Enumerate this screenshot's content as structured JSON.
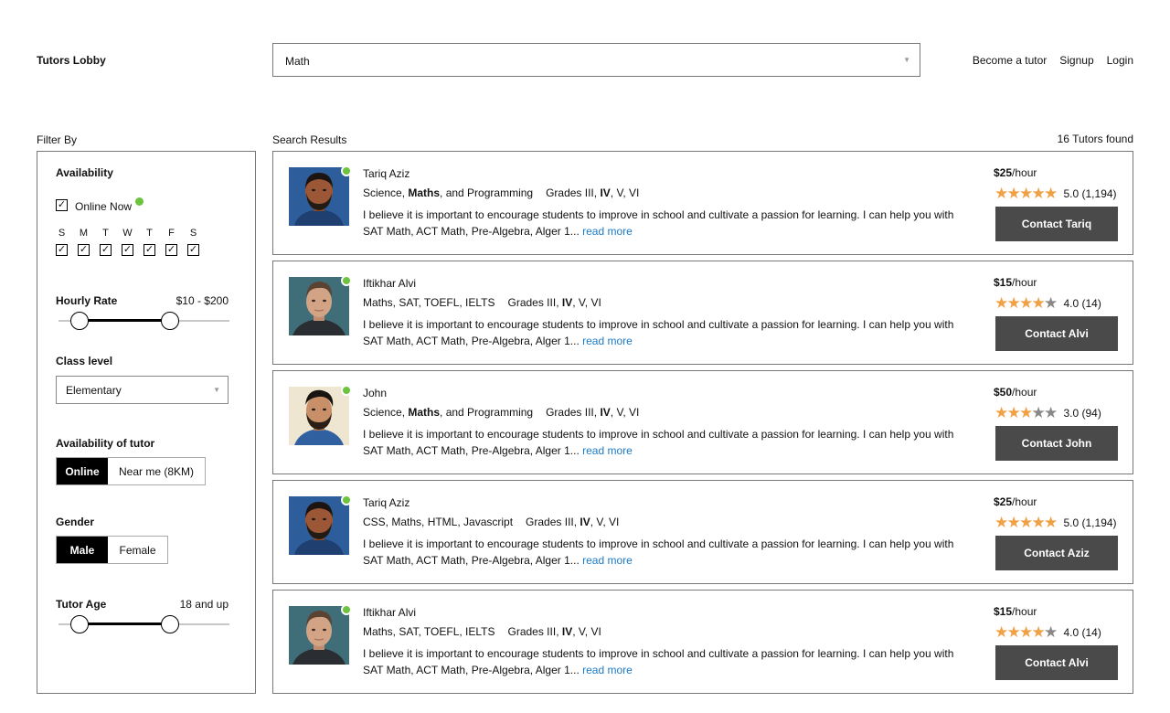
{
  "header": {
    "logo": "Tutors Lobby",
    "subject_select": "Math",
    "nav": [
      "Become a tutor",
      "Signup",
      "Login"
    ]
  },
  "filter": {
    "title": "Filter By",
    "availability_title": "Availability",
    "online_now_label": "Online Now",
    "online_now_checked": true,
    "days": [
      "S",
      "M",
      "T",
      "W",
      "T",
      "F",
      "S"
    ],
    "days_checked": [
      true,
      true,
      true,
      true,
      true,
      true,
      true
    ],
    "hourly_rate_title": "Hourly Rate",
    "hourly_rate_range": "$10 - $200",
    "class_level_title": "Class level",
    "class_level_value": "Elementary",
    "availability_tutor_title": "Availability of tutor",
    "availability_options": [
      "Online",
      "Near me (8KM)"
    ],
    "availability_selected": "Online",
    "gender_title": "Gender",
    "gender_options": [
      "Male",
      "Female"
    ],
    "gender_selected": "Male",
    "age_title": "Tutor Age",
    "age_range": "18 and up"
  },
  "results": {
    "label": "Search Results",
    "found": "16 Tutors found",
    "read_more": "read more",
    "per_hour": "/hour",
    "tutors": [
      {
        "name": "Tariq Aziz",
        "subjects": [
          "Science, ",
          "Maths",
          ", and Programming"
        ],
        "grades": [
          "Grades III, ",
          "IV",
          ", V, VI"
        ],
        "description": "I believe it is important to encourage students to improve in school and cultivate a passion for learning. I can help you with SAT Math, ACT Math, Pre-Algebra, Alger 1...",
        "price": "$25",
        "rating": 5.0,
        "rating_text": "5.0 (1,194)",
        "contact": "Contact Tariq",
        "avatar": "man-beard-blue-icon"
      },
      {
        "name": "Iftikhar Alvi",
        "subjects": [
          "Maths, SAT, TOEFL, IELTS",
          "",
          ""
        ],
        "grades": [
          "Grades III, ",
          "IV",
          ", V, VI"
        ],
        "description": "I believe it is important to encourage students to improve in school and cultivate a passion for learning. I can help you with SAT Math, ACT Math, Pre-Algebra, Alger 1...",
        "price": "$15",
        "rating": 4.0,
        "rating_text": "4.0 (14)",
        "contact": "Contact Alvi",
        "avatar": "man-teal-icon"
      },
      {
        "name": "John",
        "subjects": [
          "Science, ",
          "Maths",
          ", and Programming"
        ],
        "grades": [
          "Grades III, ",
          "IV",
          ", V, VI"
        ],
        "description": "I believe it is important to encourage students to improve in school and cultivate a passion for learning. I can help you with SAT Math, ACT Math, Pre-Algebra, Alger 1...",
        "price": "$50",
        "rating": 3.0,
        "rating_text": "3.0 (94)",
        "contact": "Contact John",
        "avatar": "man-beard-cream-icon"
      },
      {
        "name": "Tariq Aziz",
        "subjects": [
          "CSS, Maths, HTML, Javascript",
          "",
          ""
        ],
        "grades": [
          "Grades III, ",
          "IV",
          ", V, VI"
        ],
        "description": "I believe it is important to encourage students to improve in school and cultivate a passion for learning. I can help you with SAT Math, ACT Math, Pre-Algebra, Alger 1...",
        "price": "$25",
        "rating": 5.0,
        "rating_text": "5.0 (1,194)",
        "contact": "Contact Aziz",
        "avatar": "man-beard-blue-icon"
      },
      {
        "name": "Iftikhar Alvi",
        "subjects": [
          "Maths, SAT, TOEFL, IELTS",
          "",
          ""
        ],
        "grades": [
          "Grades III, ",
          "IV",
          ", V, VI"
        ],
        "description": "I believe it is important to encourage students to improve in school and cultivate a passion for learning. I can help you with SAT Math, ACT Math, Pre-Algebra, Alger 1...",
        "price": "$15",
        "rating": 4.0,
        "rating_text": "4.0 (14)",
        "contact": "Contact Alvi",
        "avatar": "man-teal-icon"
      }
    ]
  },
  "colors": {
    "online_dot": "#6cc33d",
    "star_filled": "#f0a146",
    "star_empty": "#888888",
    "link": "#1a7bc9",
    "button": "#4a4a4a"
  }
}
